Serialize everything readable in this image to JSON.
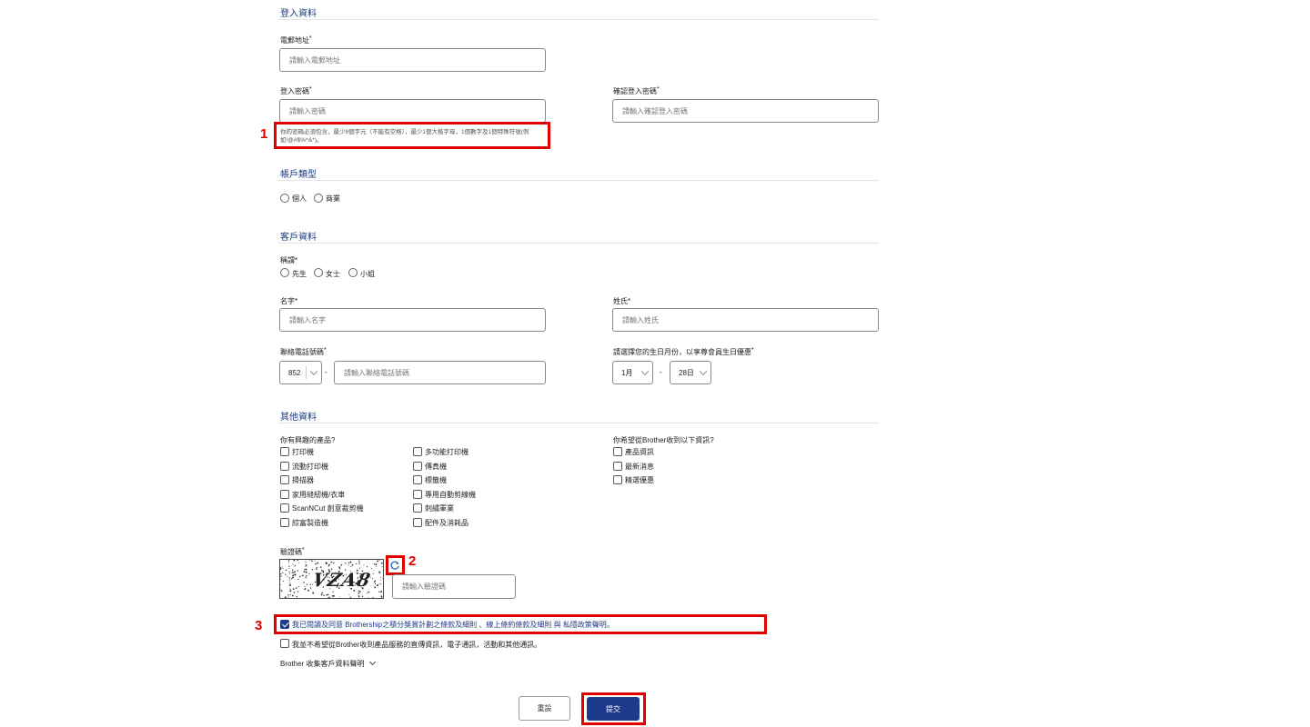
{
  "sections": {
    "login": "登入資料",
    "account_type": "帳戶類型",
    "customer": "客戶資料",
    "other": "其他資料"
  },
  "login": {
    "email_label": "電郵地址",
    "email_placeholder": "請輸入電郵地址",
    "password_label": "登入密碼",
    "password_placeholder": "請輸入密碼",
    "confirm_label": "確認登入密碼",
    "confirm_placeholder": "請輸入確認登入密碼",
    "password_hint": "你的密碼必須包含，最少8個字元（不能有空格），最少1個大楷字母，1個數字及1個特殊符號(例如!@#$%^&*)。"
  },
  "account_type": {
    "options": [
      "個人",
      "商業"
    ]
  },
  "customer": {
    "title_label": "稱謂",
    "title_options": [
      "先生",
      "女士",
      "小姐"
    ],
    "first_name_label": "名字",
    "first_name_placeholder": "請輸入名字",
    "last_name_label": "姓氏",
    "last_name_placeholder": "請輸入姓氏",
    "phone_label": "聯絡電話號碼",
    "phone_code": "852",
    "phone_dash": "-",
    "phone_placeholder": "請輸入聯絡電話號碼",
    "birthday_label": "請選擇您的生日月份，以享尊會員生日優惠",
    "birth_month": "1月",
    "birth_day": "28日",
    "birth_dash": "-"
  },
  "other": {
    "interest_label": "你有興趣的產品?",
    "products_col1": [
      "打印機",
      "流動打印機",
      "掃描器",
      "家用縫紉機/衣車",
      "ScanNCut 創意裁剪機",
      "綜富製造機"
    ],
    "products_col2": [
      "多功能打印機",
      "傳真機",
      "標籤機",
      "專用自動剪線機",
      "刺繡軍業",
      "配件及消耗品"
    ],
    "receive_label": "你希望從Brother收到以下資訊?",
    "receive_options": [
      "產品資訊",
      "最新消息",
      "精選優惠"
    ]
  },
  "captcha": {
    "label": "驗證碼",
    "image_text": "VZA8",
    "placeholder": "請輸入驗證碼"
  },
  "consent": {
    "agree_prefix": "我已閱讀及同意 Brothership之積分獎賞計劃之條款及細則 、",
    "agree_link": "線上條約條款及細則",
    "agree_mid": " 與 ",
    "agree_privacy": "私隱政策聲明",
    "agree_suffix": "。",
    "optout": "我並不希望從Brother收到產品服務的直傳資訊，電子通訊，活動和其他通訊。",
    "privacy_toggle": "Brother 收集客戶資料聲明"
  },
  "buttons": {
    "reset": "重設",
    "submit": "提交"
  },
  "annotations": [
    "1",
    "2",
    "3"
  ],
  "colors": {
    "accent": "#1e3a8a",
    "annotation_red": "#e00000"
  }
}
